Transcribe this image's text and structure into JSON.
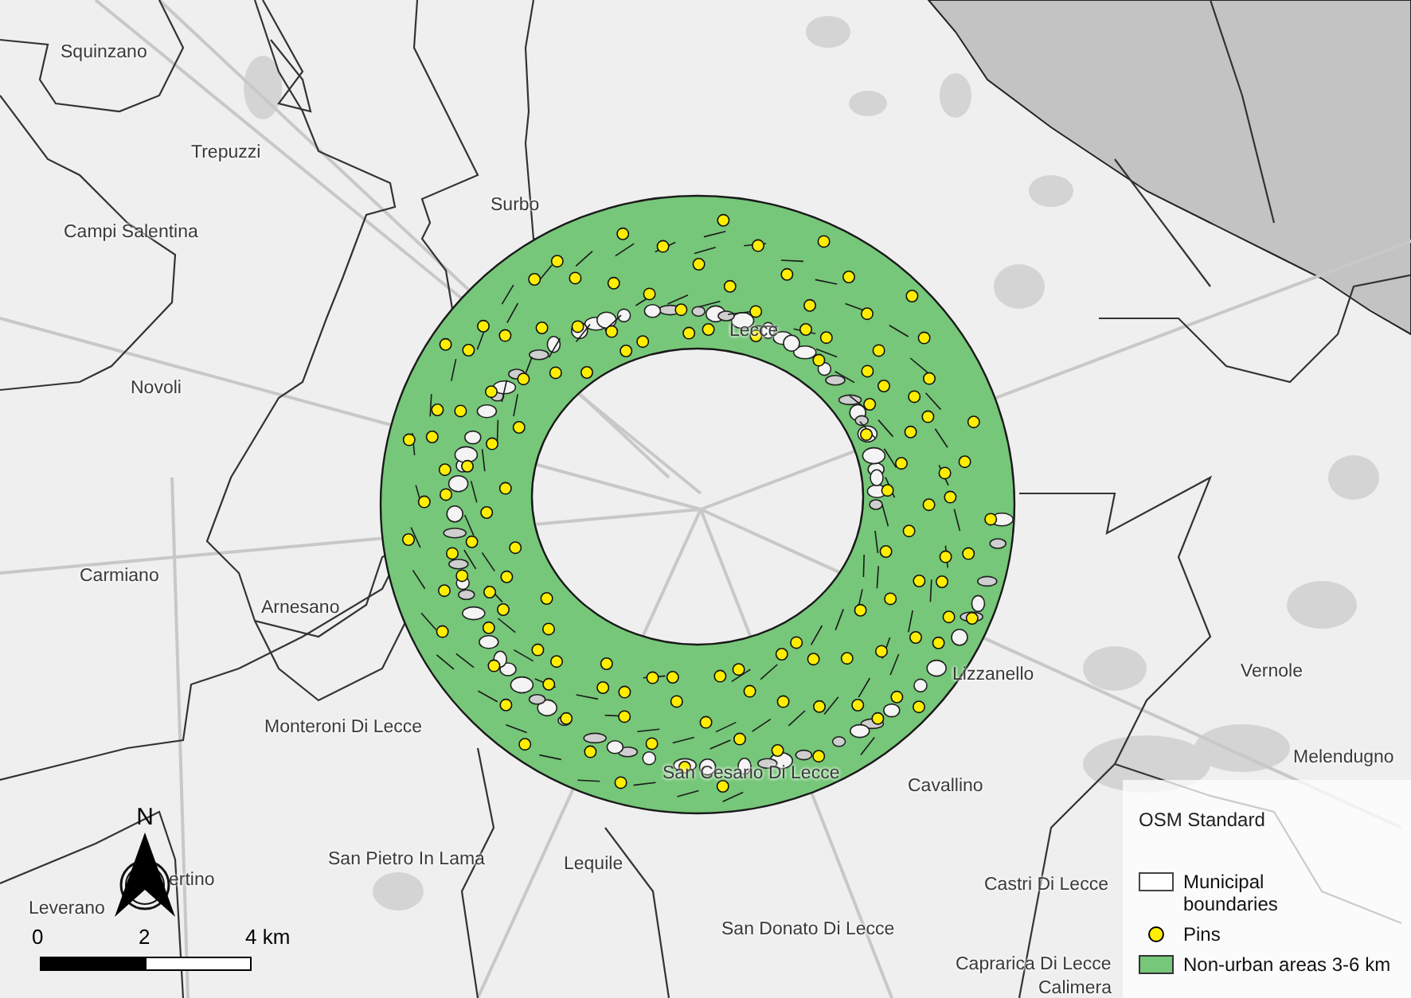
{
  "map": {
    "places": [
      "Squinzano",
      "Trepuzzi",
      "Campi Salentina",
      "Surbo",
      "Novoli",
      "Lecce",
      "Carmiano",
      "Arnesano",
      "Monteroni Di Lecce",
      "Lizzanello",
      "Vernole",
      "San Cesario Di Lecce",
      "Cavallino",
      "San Pietro In Lama",
      "Lequile",
      "ertino",
      "Leverano",
      "San Donato Di Lecce",
      "Castri Di Lecce",
      "Melendugno",
      "Caprarica Di Lecce",
      "Calimera"
    ]
  },
  "north_arrow": {
    "label": "N"
  },
  "scale_bar": {
    "ticks": [
      "0",
      "2",
      "4 km"
    ]
  },
  "legend": {
    "title": "OSM Standard",
    "items": [
      {
        "kind": "boundary",
        "label": "Municipal boundaries"
      },
      {
        "kind": "pin",
        "label": "Pins"
      },
      {
        "kind": "area",
        "label": "Non-urban areas 3-6 km"
      }
    ]
  }
}
